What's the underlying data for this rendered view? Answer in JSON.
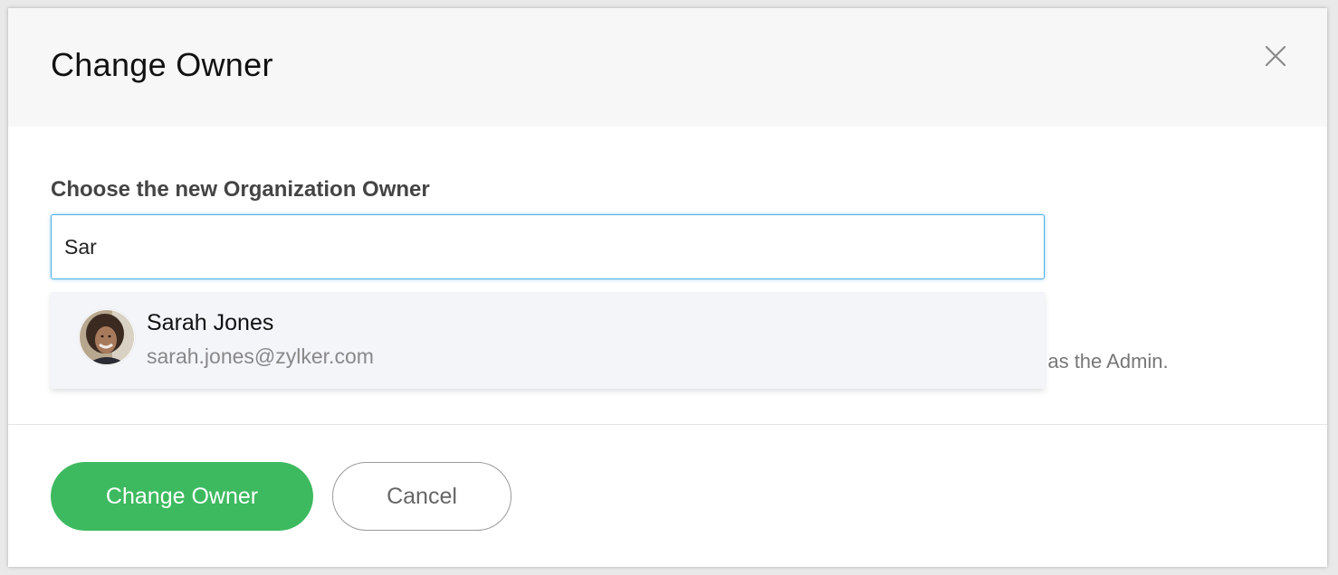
{
  "dialog": {
    "title": "Change Owner",
    "close_icon": "close-icon"
  },
  "form": {
    "label": "Choose the new Organization Owner",
    "search_value": "Sar",
    "partial_note": "d as the Admin."
  },
  "suggestions": [
    {
      "name": "Sarah Jones",
      "email": "sarah.jones@zylker.com",
      "avatar_icon": "avatar"
    }
  ],
  "actions": {
    "primary_label": "Change Owner",
    "secondary_label": "Cancel"
  },
  "colors": {
    "primary": "#3dba5f",
    "focus_border": "#4cb0e6",
    "header_bg": "#f7f7f7",
    "dropdown_bg": "#f3f5f9"
  }
}
